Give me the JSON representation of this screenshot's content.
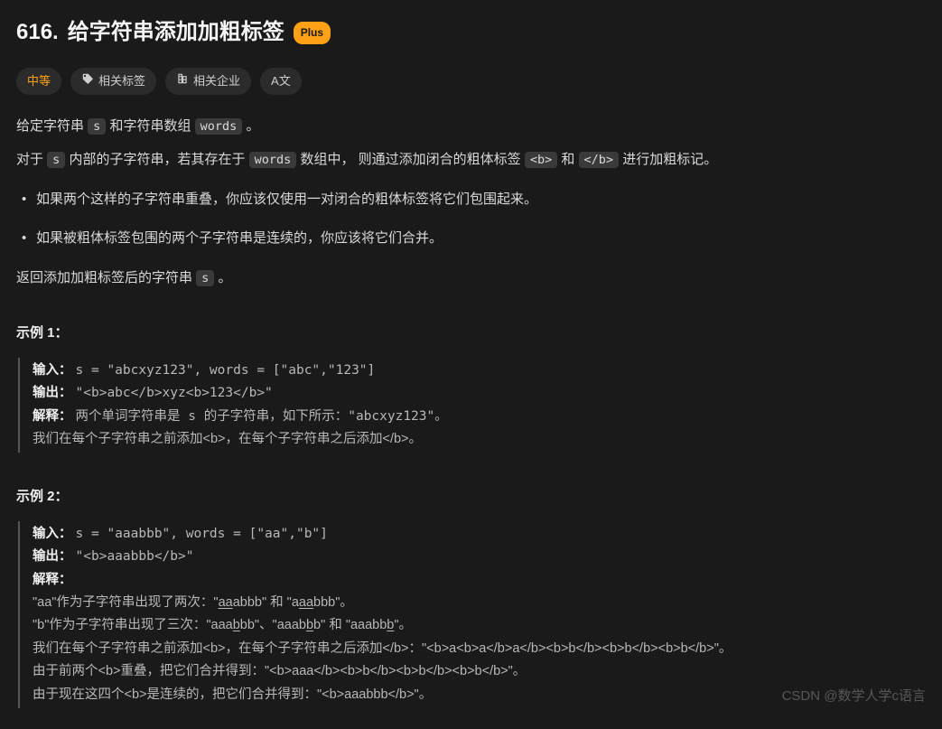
{
  "header": {
    "number": "616.",
    "title": "给字符串添加加粗标签",
    "plus": "Plus"
  },
  "chips": {
    "difficulty": "中等",
    "tags": "相关标签",
    "companies": "相关企业",
    "translate": "A文"
  },
  "desc": {
    "p1a": "给定字符串 ",
    "p1_s": "s",
    "p1b": " 和字符串数组 ",
    "p1_words": "words",
    "p1c": "。",
    "p2a": "对于 ",
    "p2_s": "s",
    "p2b": " 内部的子字符串，若其存在于 ",
    "p2_words": "words",
    "p2c": " 数组中， 则通过添加闭合的粗体标签 ",
    "p2_open": "<b>",
    "p2d": " 和 ",
    "p2_close": "</b>",
    "p2e": " 进行加粗标记。",
    "li1": "如果两个这样的子字符串重叠，你应该仅使用一对闭合的粗体标签将它们包围起来。",
    "li2": "如果被粗体标签包围的两个子字符串是连续的，你应该将它们合并。",
    "p3a": "返回添加加粗标签后的字符串 ",
    "p3_s": "s",
    "p3b": " 。"
  },
  "example1": {
    "title": "示例 1：",
    "input_label": "输入：",
    "input_val": " s = \"abcxyz123\", words = [\"abc\",\"123\"]",
    "output_label": "输出：",
    "output_val": "\"<b>abc</b>xyz<b>123</b>\"",
    "explain_label": "解释：",
    "explain_a": "两个单词字符串是 s 的子字符串，如下所示：\"abcxyz123\"。",
    "explain_b": "我们在每个子字符串之前添加<b>，在每个子字符串之后添加</b>。"
  },
  "example2": {
    "title": "示例 2：",
    "input_label": "输入：",
    "input_val": "s = \"aaabbb\", words = [\"aa\",\"b\"]",
    "output_label": "输出：",
    "output_val": "\"<b>aaabbb</b>\"",
    "explain_label": "解释：",
    "e1a": "\"aa\"作为子字符串出现了两次：\"",
    "e1u1": "aa",
    "e1b": "abbb\" 和 \"a",
    "e1u2": "aa",
    "e1c": "bbb\"。",
    "e2a": "\"b\"作为子字符串出现了三次：\"aaa",
    "e2u1": "b",
    "e2b": "bb\"、\"aaab",
    "e2u2": "b",
    "e2c": "b\" 和 \"aaabb",
    "e2u3": "b",
    "e2d": "\"。",
    "e3": "我们在每个子字符串之前添加<b>，在每个子字符串之后添加</b>：\"<b>a<b>a</b>a</b><b>b</b><b>b</b><b>b</b>\"。",
    "e4": "由于前两个<b>重叠，把它们合并得到：\"<b>aaa</b><b>b</b><b>b</b><b>b</b>\"。",
    "e5": "由于现在这四个<b>是连续的，把它们合并得到：\"<b>aaabbb</b>\"。"
  },
  "watermark": "CSDN @数学人学c语言"
}
